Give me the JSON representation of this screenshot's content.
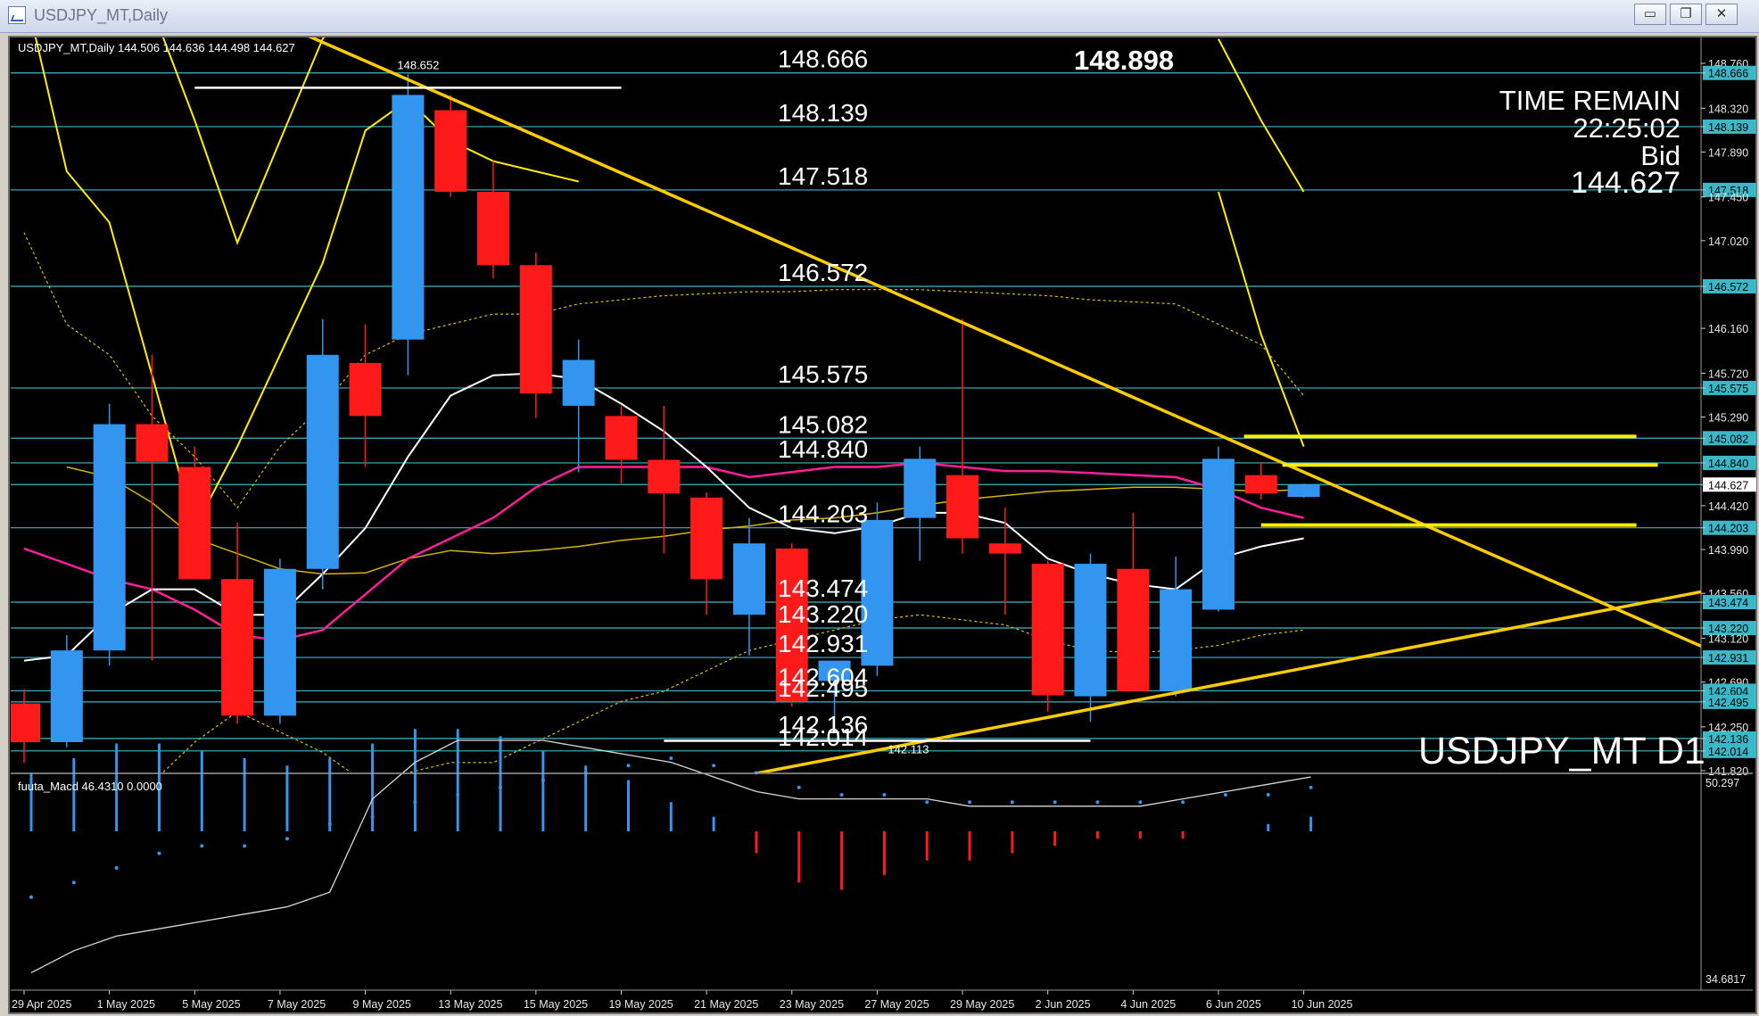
{
  "window": {
    "title": "USDJPY_MT,Daily",
    "controls": [
      "minimize",
      "restore",
      "close"
    ],
    "control_icons": {
      "minimize": "▭",
      "restore": "❐",
      "close": "✕"
    }
  },
  "header_text": "USDJPY_MT,Daily  144.506 144.636 144.498 144.627",
  "top_value": "148.898",
  "time_remain": {
    "label": "TIME REMAIN",
    "value": "22:25:02",
    "bid_label": "Bid",
    "bid_value": "144.627"
  },
  "symbol_label": "USDJPY_MT D1",
  "macd_label": "fuuta_Macd 46.4310  0.0000",
  "colors": {
    "bg": "#000000",
    "bull": "#3296f0",
    "bear": "#ff1a1a",
    "yellow": "#ffee00",
    "orange": "#ffcc00",
    "cyan_line": "#3ab8c8",
    "white_ma": "#ffffff",
    "pink_ma": "#ff1e9a"
  },
  "chart_data": {
    "type": "candlestick",
    "price_axis_labels": [
      "148.760",
      "148.666",
      "148.320",
      "148.139",
      "147.890",
      "147.518",
      "147.450",
      "147.020",
      "146.572",
      "146.160",
      "145.720",
      "145.575",
      "145.290",
      "145.082",
      "144.840",
      "144.627",
      "144.420",
      "144.203",
      "143.990",
      "143.560",
      "143.474",
      "143.220",
      "143.120",
      "142.931",
      "142.690",
      "142.604",
      "142.495",
      "142.250",
      "142.136",
      "142.014",
      "141.820"
    ],
    "macd_axis_labels": [
      "50.297",
      "34.6817"
    ],
    "date_labels": [
      "29 Apr 2025",
      "1 May 2025",
      "5 May 2025",
      "7 May 2025",
      "9 May 2025",
      "13 May 2025",
      "15 May 2025",
      "19 May 2025",
      "21 May 2025",
      "23 May 2025",
      "27 May 2025",
      "29 May 2025",
      "2 Jun 2025",
      "4 Jun 2025",
      "6 Jun 2025",
      "10 Jun 2025"
    ],
    "level_lines": [
      148.666,
      148.139,
      147.518,
      146.572,
      145.575,
      145.082,
      144.84,
      144.627,
      144.203,
      143.474,
      143.22,
      142.931,
      142.604,
      142.495,
      142.136,
      142.014
    ],
    "level_labels": [
      {
        "text": "148.666",
        "price": 148.666
      },
      {
        "text": "148.139",
        "price": 148.139
      },
      {
        "text": "147.518",
        "price": 147.518
      },
      {
        "text": "146.572",
        "price": 146.572
      },
      {
        "text": "145.575",
        "price": 145.575
      },
      {
        "text": "145.082",
        "price": 145.082
      },
      {
        "text": "144.840",
        "price": 144.84
      },
      {
        "text": "144.203",
        "price": 144.203
      },
      {
        "text": "143.474",
        "price": 143.474
      },
      {
        "text": "143.220",
        "price": 143.22
      },
      {
        "text": "142.931",
        "price": 142.931
      },
      {
        "text": "142.604",
        "price": 142.604
      },
      {
        "text": "142.495",
        "price": 142.495
      },
      {
        "text": "142.136",
        "price": 142.136
      },
      {
        "text": "142.014",
        "price": 142.014
      }
    ],
    "high_marker": {
      "text": "148.652",
      "price": 148.652,
      "bar": 9
    },
    "low_marker": {
      "text": "142.113",
      "price": 142.113,
      "bar": 20
    },
    "candles": [
      {
        "o": 142.48,
        "h": 142.62,
        "l": 141.9,
        "c": 142.1
      },
      {
        "o": 142.1,
        "h": 143.15,
        "l": 142.05,
        "c": 143.0
      },
      {
        "o": 143.0,
        "h": 145.42,
        "l": 142.85,
        "c": 145.22
      },
      {
        "o": 145.22,
        "h": 145.9,
        "l": 142.9,
        "c": 144.85
      },
      {
        "o": 144.8,
        "h": 145.0,
        "l": 143.7,
        "c": 143.7
      },
      {
        "o": 143.7,
        "h": 144.25,
        "l": 142.28,
        "c": 142.36
      },
      {
        "o": 142.36,
        "h": 143.9,
        "l": 142.28,
        "c": 143.8
      },
      {
        "o": 143.8,
        "h": 146.25,
        "l": 143.6,
        "c": 145.9
      },
      {
        "o": 145.82,
        "h": 146.2,
        "l": 144.8,
        "c": 145.3
      },
      {
        "o": 146.05,
        "h": 148.652,
        "l": 145.7,
        "c": 148.45
      },
      {
        "o": 148.3,
        "h": 148.45,
        "l": 147.45,
        "c": 147.5
      },
      {
        "o": 147.5,
        "h": 147.8,
        "l": 146.65,
        "c": 146.78
      },
      {
        "o": 146.78,
        "h": 146.9,
        "l": 145.28,
        "c": 145.52
      },
      {
        "o": 145.4,
        "h": 146.05,
        "l": 144.75,
        "c": 145.85
      },
      {
        "o": 145.3,
        "h": 145.4,
        "l": 144.64,
        "c": 144.87
      },
      {
        "o": 144.87,
        "h": 145.4,
        "l": 143.95,
        "c": 144.54
      },
      {
        "o": 144.5,
        "h": 144.55,
        "l": 143.35,
        "c": 143.7
      },
      {
        "o": 143.35,
        "h": 144.3,
        "l": 142.95,
        "c": 144.05
      },
      {
        "o": 144.0,
        "h": 144.05,
        "l": 142.45,
        "c": 142.5
      },
      {
        "o": 142.7,
        "h": 142.9,
        "l": 142.2,
        "c": 142.9
      },
      {
        "o": 142.85,
        "h": 144.45,
        "l": 142.75,
        "c": 144.28
      },
      {
        "o": 144.3,
        "h": 145.0,
        "l": 143.88,
        "c": 144.88
      },
      {
        "o": 144.72,
        "h": 146.25,
        "l": 143.95,
        "c": 144.1
      },
      {
        "o": 144.05,
        "h": 144.4,
        "l": 143.35,
        "c": 143.95
      },
      {
        "o": 143.85,
        "h": 143.88,
        "l": 142.4,
        "c": 142.56
      },
      {
        "o": 142.55,
        "h": 143.95,
        "l": 142.3,
        "c": 143.85
      },
      {
        "o": 143.8,
        "h": 144.35,
        "l": 142.6,
        "c": 142.6
      },
      {
        "o": 142.6,
        "h": 143.92,
        "l": 142.55,
        "c": 143.6
      },
      {
        "o": 143.4,
        "h": 145.0,
        "l": 143.38,
        "c": 144.88
      },
      {
        "o": 144.72,
        "h": 144.85,
        "l": 144.48,
        "c": 144.54
      },
      {
        "o": 144.506,
        "h": 144.636,
        "l": 144.498,
        "c": 144.627
      }
    ],
    "ma_white": [
      142.9,
      142.95,
      143.35,
      143.6,
      143.6,
      143.35,
      143.35,
      143.75,
      144.2,
      144.9,
      145.5,
      145.7,
      145.72,
      145.66,
      145.42,
      145.15,
      144.8,
      144.4,
      144.2,
      144.15,
      144.22,
      144.35,
      144.35,
      144.25,
      143.9,
      143.75,
      143.65,
      143.6,
      143.9,
      144.02,
      144.1
    ],
    "ma_pink": [
      144.0,
      143.85,
      143.7,
      143.6,
      143.4,
      143.15,
      143.1,
      143.2,
      143.55,
      143.9,
      144.1,
      144.3,
      144.6,
      144.8,
      144.8,
      144.8,
      144.8,
      144.7,
      144.75,
      144.8,
      144.8,
      144.84,
      144.8,
      144.76,
      144.76,
      144.74,
      144.72,
      144.7,
      144.58,
      144.4,
      144.3
    ],
    "ma_orange": [
      null,
      144.8,
      144.7,
      144.45,
      144.1,
      143.95,
      143.8,
      143.75,
      143.76,
      143.9,
      143.98,
      143.95,
      143.98,
      144.02,
      144.08,
      144.12,
      144.18,
      144.22,
      144.28,
      144.3,
      144.35,
      144.42,
      144.48,
      144.52,
      144.56,
      144.58,
      144.6,
      144.6,
      144.58,
      144.56,
      144.58
    ],
    "bb_upper": [
      151.5,
      150.5,
      150.0,
      149.3,
      148.2,
      147.0,
      148.0,
      149.0,
      149.5,
      150.5,
      150.8,
      150.3,
      150.0,
      151.0,
      null,
      null,
      null,
      null,
      null,
      null,
      null,
      null,
      null,
      null,
      null,
      null,
      null,
      null,
      149.0,
      148.2,
      147.5
    ],
    "bb_mid": [
      149.5,
      147.7,
      147.2,
      145.7,
      144.2,
      145.0,
      145.9,
      146.8,
      148.1,
      148.4,
      148.0,
      147.8,
      147.7,
      147.6,
      null,
      null,
      null,
      null,
      null,
      null,
      null,
      null,
      null,
      null,
      null,
      null,
      null,
      null,
      147.5,
      146.1,
      145.0
    ],
    "env_upper_dotted": [
      147.1,
      146.2,
      145.9,
      145.3,
      144.9,
      144.4,
      145.0,
      145.4,
      145.9,
      146.1,
      146.2,
      146.3,
      146.3,
      146.4,
      146.44,
      146.48,
      146.5,
      146.52,
      146.52,
      146.54,
      146.54,
      146.54,
      146.52,
      146.5,
      146.48,
      146.44,
      146.42,
      146.4,
      146.2,
      146.0,
      145.5
    ],
    "env_lower_dotted": [
      139.9,
      140.6,
      141.0,
      141.7,
      142.1,
      142.4,
      142.2,
      142.0,
      141.7,
      141.8,
      141.9,
      141.9,
      142.1,
      142.3,
      142.5,
      142.6,
      142.8,
      143.0,
      143.1,
      143.2,
      143.3,
      143.35,
      143.3,
      143.25,
      143.1,
      143.0,
      142.98,
      143.0,
      143.05,
      143.15,
      143.2
    ],
    "trend_lines": [
      {
        "name": "down-trend",
        "p1": {
          "bar": 9,
          "price": 148.6
        },
        "p2": {
          "bar": 39,
          "price": 143.1
        }
      },
      {
        "name": "up-trend",
        "p1": {
          "bar": 17,
          "price": 141.78
        },
        "p2": {
          "bar": 39,
          "price": 143.55
        }
      }
    ],
    "yellow_segments": [
      {
        "price": 145.1,
        "from_bar": 28.6,
        "to_bar": 37.8
      },
      {
        "price": 144.82,
        "from_bar": 29.5,
        "to_bar": 38.3
      },
      {
        "price": 144.23,
        "from_bar": 29.0,
        "to_bar": 37.8
      }
    ],
    "white_segments": [
      {
        "price": 148.52,
        "from_bar": 4.0,
        "to_bar": 14.0
      },
      {
        "price": 142.113,
        "from_bar": 15.0,
        "to_bar": 25.0
      }
    ],
    "macd_hist": [
      8,
      10,
      12,
      12,
      11,
      10,
      9,
      10,
      12,
      14,
      14,
      13,
      11,
      9,
      7,
      4,
      2,
      -3,
      -7,
      -8,
      -6,
      -4,
      -4,
      -3,
      -2,
      -1,
      -1,
      -1,
      0,
      1,
      2
    ],
    "macd_signal": [
      -9,
      -7,
      -5,
      -3,
      -2,
      -2,
      -1,
      1,
      2,
      4,
      5,
      6,
      7,
      8,
      9,
      10,
      9,
      8,
      6,
      5,
      5,
      4,
      4,
      4,
      4,
      4,
      4,
      4,
      5,
      5,
      6
    ],
    "macd_line_white": [
      -12,
      -9,
      -7,
      -6,
      -5,
      -4,
      -3,
      -1,
      2,
      7,
      10,
      10,
      10,
      9,
      8,
      7,
      5,
      3,
      2,
      2,
      2,
      2,
      1,
      1,
      1,
      1,
      1,
      2,
      3,
      4,
      5
    ]
  }
}
